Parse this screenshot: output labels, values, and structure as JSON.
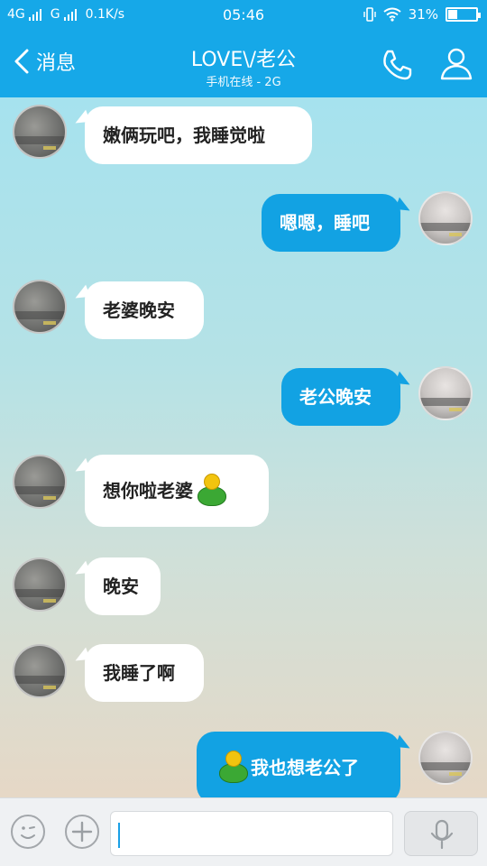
{
  "status": {
    "network_1": "4G",
    "network_2": "G",
    "speed": "0.1K/s",
    "time": "05:46",
    "battery": "31%",
    "battery_level": 0.31
  },
  "header": {
    "back_label": "消息",
    "title": "LOVE\\/老公",
    "subtitle": "手机在线 - 2G"
  },
  "messages": [
    {
      "side": "in",
      "text": "嫩俩玩吧，我睡觉啦"
    },
    {
      "side": "out",
      "text": "嗯嗯，睡吧"
    },
    {
      "side": "in",
      "text": "老婆晚安"
    },
    {
      "side": "out",
      "text": "老公晚安"
    },
    {
      "side": "in",
      "text": "想你啦老婆",
      "emoji": "green-doll-emoji"
    },
    {
      "side": "in",
      "text": "晚安"
    },
    {
      "side": "in",
      "text": "我睡了啊"
    },
    {
      "side": "out",
      "text": "我也想老公了",
      "emoji": "green-doll-emoji"
    }
  ],
  "colors": {
    "accent": "#16a8e8",
    "out_bubble": "#12a2e3",
    "in_bubble": "#ffffff"
  },
  "icons": {
    "back": "chevron-left-icon",
    "call": "phone-icon",
    "profile": "person-icon",
    "emoji_button": "smiley-icon",
    "plus_button": "plus-icon",
    "mic_button": "microphone-icon"
  }
}
